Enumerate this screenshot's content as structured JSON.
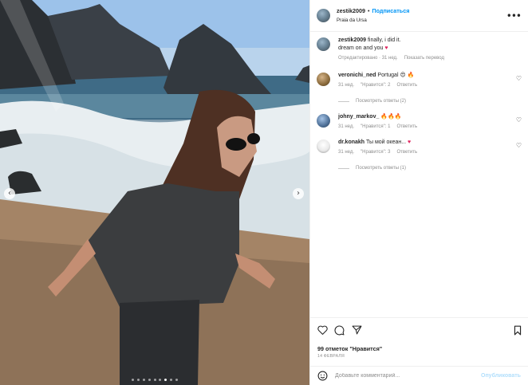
{
  "post": {
    "username": "zestik2009",
    "separator": "•",
    "follow_label": "Подписаться",
    "location": "Praia da Ursa",
    "more_icon": "more-horizontal-icon"
  },
  "caption": {
    "username": "zestik2009",
    "text": "finally, i did it.",
    "text2": "dream on and you",
    "heart": "♥",
    "edited": "Отредактировано · 31 нед.",
    "translate": "Показать перевод"
  },
  "comments": [
    {
      "username": "veronichi_ned",
      "text": "Portugal 😍 🔥",
      "time": "31 нед.",
      "likes": "\"Нравится\": 2",
      "reply": "Ответить",
      "view_replies": "Посмотреть ответы (2)"
    },
    {
      "username": "johny_markov_",
      "text": "🔥🔥🔥",
      "time": "31 нед.",
      "likes": "\"Нравится\": 1",
      "reply": "Ответить"
    },
    {
      "username": "dr.konakh",
      "text": "Ты мой океан...",
      "heart": "♥",
      "time": "31 нед.",
      "likes": "\"Нравится\": 3",
      "reply": "Ответить",
      "view_replies": "Посмотреть ответы (1)"
    }
  ],
  "footer": {
    "likes": "99 отметок \"Нравится\"",
    "date": "14 ФЕВРАЛЯ",
    "comment_placeholder": "Добавьте комментарий...",
    "publish": "Опубликовать"
  },
  "carousel": {
    "slides": 9,
    "active_index": 6
  },
  "colors": {
    "accent": "#0095f6",
    "heart": "#e0245e",
    "muted": "#8e8e8e"
  }
}
